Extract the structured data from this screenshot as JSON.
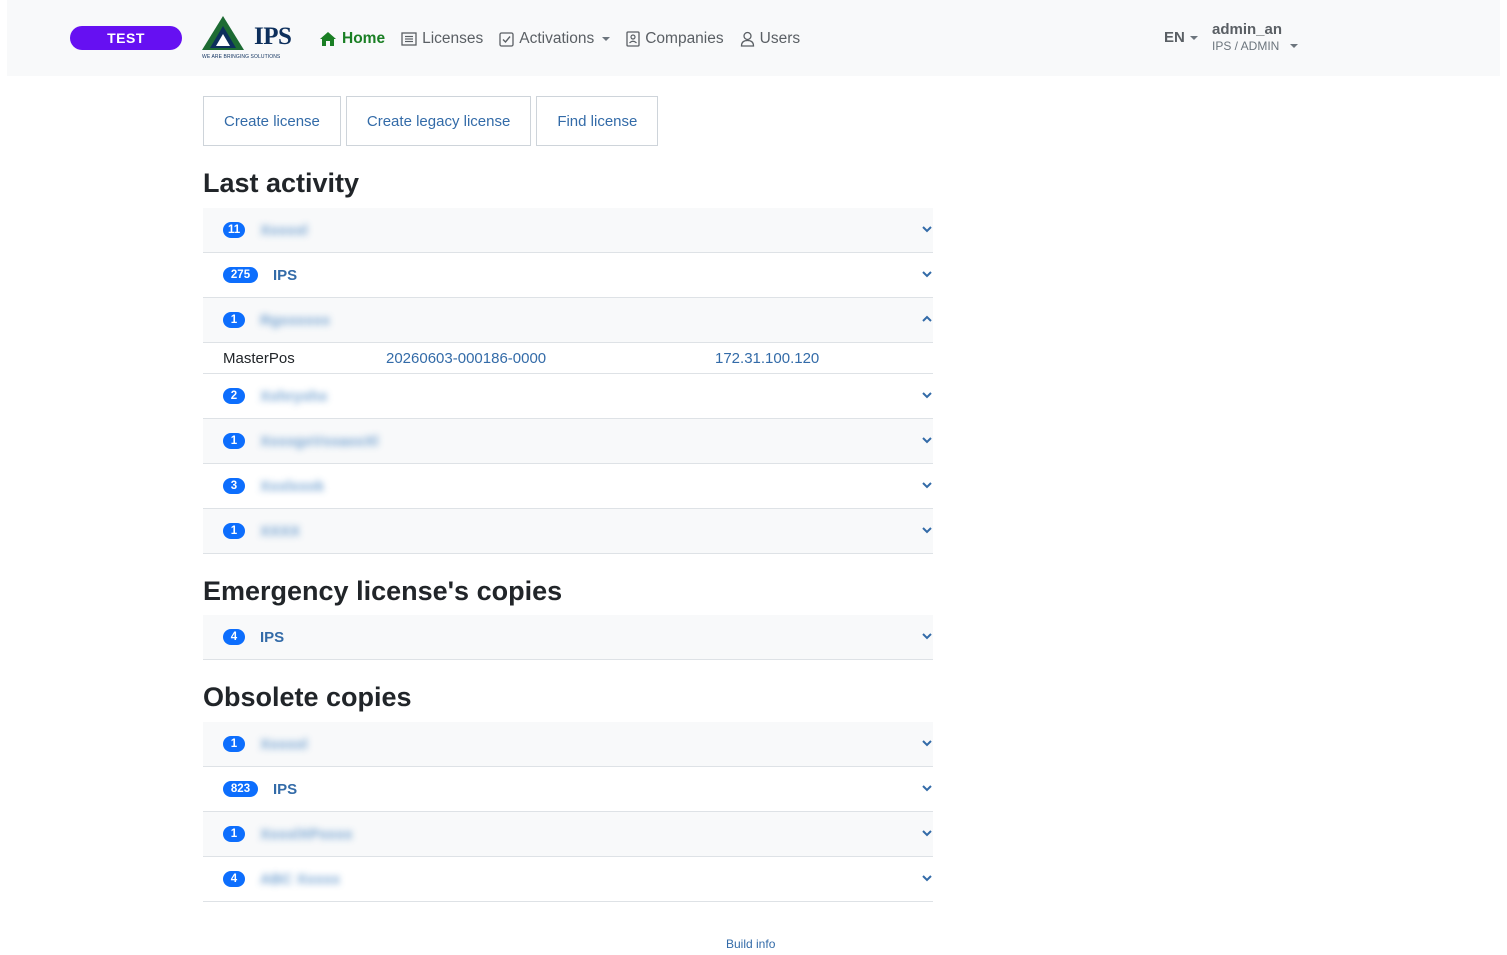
{
  "navbar": {
    "env_badge": "TEST",
    "logo": {
      "text": "IPS",
      "tagline": "WE ARE BRINGING SOLUTIONS"
    },
    "items": [
      {
        "label": "Home",
        "icon": "home-icon",
        "active": true
      },
      {
        "label": "Licenses",
        "icon": "list-icon"
      },
      {
        "label": "Activations",
        "icon": "check-square-icon",
        "dropdown": true
      },
      {
        "label": "Companies",
        "icon": "id-card-icon"
      },
      {
        "label": "Users",
        "icon": "user-icon"
      }
    ],
    "language": "EN",
    "user": {
      "name": "admin_an",
      "role": "IPS / ADMIN"
    }
  },
  "actions": {
    "create_license": "Create license",
    "create_legacy_license": "Create legacy license",
    "find_license": "Find license"
  },
  "last_activity": {
    "title": "Last activity",
    "rows": [
      {
        "count": "11",
        "label": "Xxxxxl",
        "blurred": true,
        "expanded": false
      },
      {
        "count": "275",
        "label": "IPS",
        "blurred": false,
        "expanded": false
      },
      {
        "count": "1",
        "label": "Rgxxxxxx",
        "blurred": true,
        "expanded": true
      },
      {
        "count": "2",
        "label": "Xxhryxhx",
        "blurred": true,
        "expanded": false
      },
      {
        "count": "1",
        "label": "XxxxgxVxxaxxXl",
        "blurred": true,
        "expanded": false
      },
      {
        "count": "3",
        "label": "Xxxlxxxk",
        "blurred": true,
        "expanded": false
      },
      {
        "count": "1",
        "label": "XXXX",
        "blurred": true,
        "expanded": false
      }
    ],
    "expanded_detail": {
      "product": "MasterPos",
      "license_id": "20260603-000186-0000",
      "ip": "172.31.100.120"
    }
  },
  "emergency": {
    "title": "Emergency license's copies",
    "rows": [
      {
        "count": "4",
        "label": "IPS",
        "blurred": false
      }
    ]
  },
  "obsolete": {
    "title": "Obsolete copies",
    "rows": [
      {
        "count": "1",
        "label": "Xxxxxl",
        "blurred": true
      },
      {
        "count": "823",
        "label": "IPS",
        "blurred": false
      },
      {
        "count": "1",
        "label": "XxxxlXPxxxx",
        "blurred": true
      },
      {
        "count": "4",
        "label": "ABC Xxxxx",
        "blurred": true
      }
    ]
  },
  "footer": {
    "build_info": "Build info"
  },
  "colors": {
    "accent": "#0d6efd",
    "link": "#336ba8",
    "active_nav": "#1a7f24",
    "env_badge": "#6610f2"
  }
}
